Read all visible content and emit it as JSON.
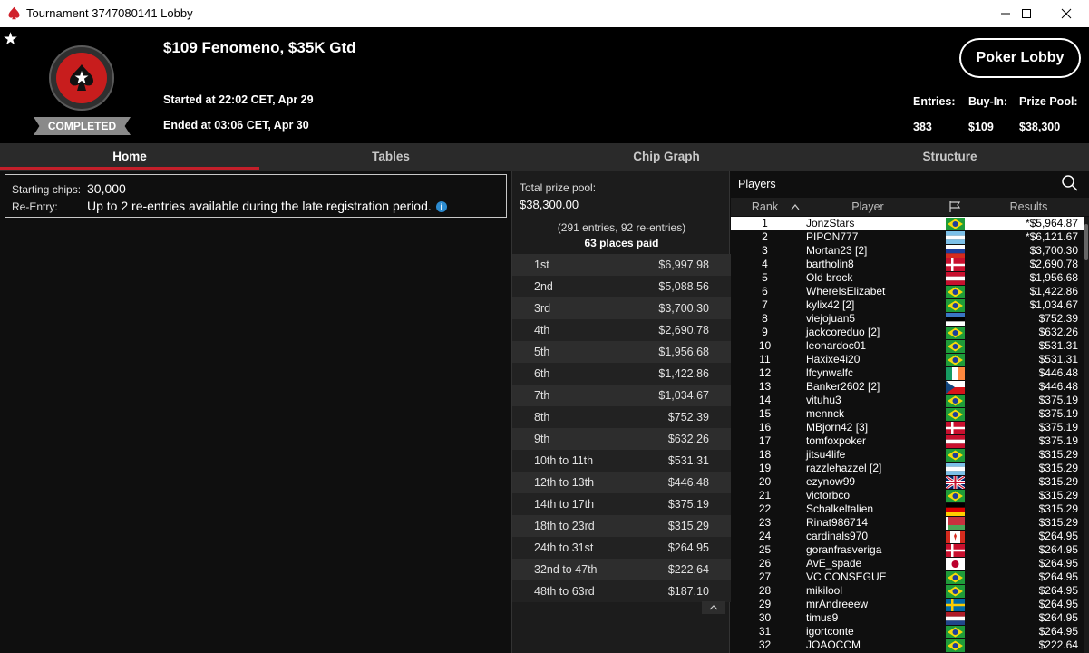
{
  "window": {
    "title": "Tournament 3747080141 Lobby"
  },
  "header": {
    "tournament_name": "$109 Fenomeno, $35K Gtd",
    "started": "Started at 22:02 CET, Apr 29",
    "ended": "Ended at 03:06 CET, Apr 30",
    "status": "COMPLETED",
    "lobby_button": "Poker Lobby",
    "stats": [
      {
        "label": "Entries:",
        "value": "383"
      },
      {
        "label": "Buy-In:",
        "value": "$109"
      },
      {
        "label": "Prize Pool:",
        "value": "$38,300"
      }
    ]
  },
  "tabs": [
    {
      "label": "Home",
      "active": true
    },
    {
      "label": "Tables",
      "active": false
    },
    {
      "label": "Chip Graph",
      "active": false
    },
    {
      "label": "Structure",
      "active": false
    }
  ],
  "info": {
    "starting_chips_label": "Starting chips:",
    "starting_chips_value": "30,000",
    "reentry_label": "Re-Entry:",
    "reentry_value": "Up to 2 re-entries available during the late registration period.",
    "info_icon_glyph": "i"
  },
  "prize": {
    "label": "Total prize pool:",
    "total": "$38,300.00",
    "entries_line": "(291 entries, 92 re-entries)",
    "places_paid": "63 places paid",
    "payouts": [
      {
        "place": "1st",
        "amount": "$6,997.98"
      },
      {
        "place": "2nd",
        "amount": "$5,088.56"
      },
      {
        "place": "3rd",
        "amount": "$3,700.30"
      },
      {
        "place": "4th",
        "amount": "$2,690.78"
      },
      {
        "place": "5th",
        "amount": "$1,956.68"
      },
      {
        "place": "6th",
        "amount": "$1,422.86"
      },
      {
        "place": "7th",
        "amount": "$1,034.67"
      },
      {
        "place": "8th",
        "amount": "$752.39"
      },
      {
        "place": "9th",
        "amount": "$632.26"
      },
      {
        "place": "10th to 11th",
        "amount": "$531.31"
      },
      {
        "place": "12th to 13th",
        "amount": "$446.48"
      },
      {
        "place": "14th to 17th",
        "amount": "$375.19"
      },
      {
        "place": "18th to 23rd",
        "amount": "$315.29"
      },
      {
        "place": "24th to 31st",
        "amount": "$264.95"
      },
      {
        "place": "32nd to 47th",
        "amount": "$222.64"
      },
      {
        "place": "48th to 63rd",
        "amount": "$187.10"
      }
    ]
  },
  "players": {
    "title": "Players",
    "columns": {
      "rank": "Rank",
      "player": "Player",
      "results": "Results"
    },
    "rows": [
      {
        "rank": "1",
        "name": "JonzStars",
        "flag": "br",
        "result": "*$5,964.87"
      },
      {
        "rank": "2",
        "name": "PIPON777",
        "flag": "ar",
        "result": "*$6,121.67"
      },
      {
        "rank": "3",
        "name": "Mortan23 [2]",
        "flag": "si",
        "result": "$3,700.30"
      },
      {
        "rank": "4",
        "name": "bartholin8",
        "flag": "dk",
        "result": "$2,690.78"
      },
      {
        "rank": "5",
        "name": "Old brock",
        "flag": "at",
        "result": "$1,956.68"
      },
      {
        "rank": "6",
        "name": "WhereIsElizabet",
        "flag": "br",
        "result": "$1,422.86"
      },
      {
        "rank": "7",
        "name": "kylix42 [2]",
        "flag": "br",
        "result": "$1,034.67"
      },
      {
        "rank": "8",
        "name": "viejojuan5",
        "flag": "ee",
        "result": "$752.39"
      },
      {
        "rank": "9",
        "name": "jackcoreduo [2]",
        "flag": "br",
        "result": "$632.26"
      },
      {
        "rank": "10",
        "name": "leonardoc01",
        "flag": "br",
        "result": "$531.31"
      },
      {
        "rank": "11",
        "name": "Haxixe4i20",
        "flag": "br",
        "result": "$531.31"
      },
      {
        "rank": "12",
        "name": "lfcynwalfc",
        "flag": "ie",
        "result": "$446.48"
      },
      {
        "rank": "13",
        "name": "Banker2602 [2]",
        "flag": "cz",
        "result": "$446.48"
      },
      {
        "rank": "14",
        "name": "vituhu3",
        "flag": "br",
        "result": "$375.19"
      },
      {
        "rank": "15",
        "name": "mennck",
        "flag": "br",
        "result": "$375.19"
      },
      {
        "rank": "16",
        "name": "MBjorn42 [3]",
        "flag": "dk",
        "result": "$375.19"
      },
      {
        "rank": "17",
        "name": "tomfoxpoker",
        "flag": "at",
        "result": "$375.19"
      },
      {
        "rank": "18",
        "name": "jitsu4life",
        "flag": "br",
        "result": "$315.29"
      },
      {
        "rank": "19",
        "name": "razzlehazzel [2]",
        "flag": "ar",
        "result": "$315.29"
      },
      {
        "rank": "20",
        "name": "ezynow99",
        "flag": "gb",
        "result": "$315.29"
      },
      {
        "rank": "21",
        "name": "victorbco",
        "flag": "br",
        "result": "$315.29"
      },
      {
        "rank": "22",
        "name": "Schalkeltalien",
        "flag": "de",
        "result": "$315.29"
      },
      {
        "rank": "23",
        "name": "Rinat986714",
        "flag": "by",
        "result": "$315.29"
      },
      {
        "rank": "24",
        "name": "cardinals970",
        "flag": "ca",
        "result": "$264.95"
      },
      {
        "rank": "25",
        "name": "goranfrasveriga",
        "flag": "dk",
        "result": "$264.95"
      },
      {
        "rank": "26",
        "name": "AvE_spade",
        "flag": "jp",
        "result": "$264.95"
      },
      {
        "rank": "27",
        "name": "VC CONSEGUE",
        "flag": "br",
        "result": "$264.95"
      },
      {
        "rank": "28",
        "name": "mikilool",
        "flag": "br",
        "result": "$264.95"
      },
      {
        "rank": "29",
        "name": "mrAndreeew",
        "flag": "se",
        "result": "$264.95"
      },
      {
        "rank": "30",
        "name": "timus9",
        "flag": "nl",
        "result": "$264.95"
      },
      {
        "rank": "31",
        "name": "igortconte",
        "flag": "br",
        "result": "$264.95"
      },
      {
        "rank": "32",
        "name": "JOAOCCM",
        "flag": "br",
        "result": "$222.64"
      }
    ]
  },
  "colors": {
    "accent_red": "#c41f2a",
    "background": "#0f0f0f",
    "panel": "#1c1c1c"
  }
}
